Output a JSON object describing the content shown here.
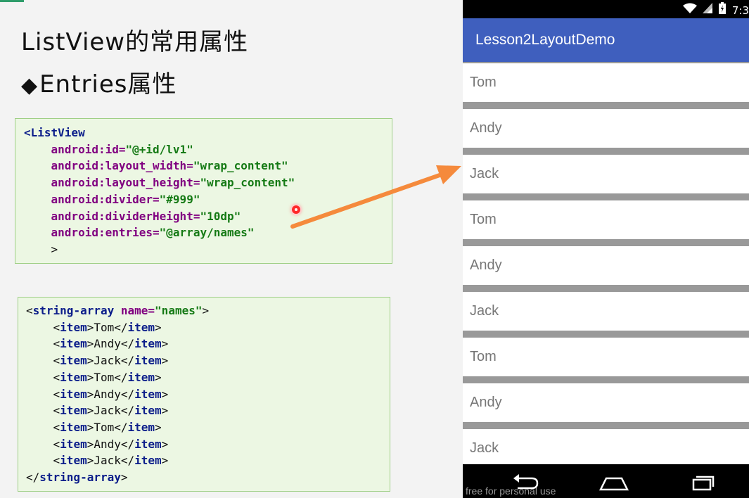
{
  "slide": {
    "title": "ListView的常用属性",
    "subtitle_bullet": "◆",
    "subtitle": "Entries属性",
    "code_listview": [
      [
        {
          "t": "tag",
          "s": "<ListView"
        }
      ],
      [
        {
          "t": "plain",
          "s": "    "
        },
        {
          "t": "attr",
          "s": "android:id="
        },
        {
          "t": "val",
          "s": "\"@+id/lv1\""
        }
      ],
      [
        {
          "t": "plain",
          "s": "    "
        },
        {
          "t": "attr",
          "s": "android:layout_width="
        },
        {
          "t": "val",
          "s": "\"wrap_content\""
        }
      ],
      [
        {
          "t": "plain",
          "s": "    "
        },
        {
          "t": "attr",
          "s": "android:layout_height="
        },
        {
          "t": "val",
          "s": "\"wrap_content\""
        }
      ],
      [
        {
          "t": "plain",
          "s": "    "
        },
        {
          "t": "attr",
          "s": "android:divider="
        },
        {
          "t": "val",
          "s": "\"#999\""
        }
      ],
      [
        {
          "t": "plain",
          "s": "    "
        },
        {
          "t": "attr",
          "s": "android:dividerHeight="
        },
        {
          "t": "val",
          "s": "\"10dp\""
        }
      ],
      [
        {
          "t": "plain",
          "s": "    "
        },
        {
          "t": "attr",
          "s": "android:entries="
        },
        {
          "t": "val",
          "s": "\"@array/names\""
        }
      ],
      [
        {
          "t": "plain",
          "s": "    >"
        }
      ]
    ],
    "code_string_array": [
      [
        {
          "t": "plain",
          "s": "<"
        },
        {
          "t": "tag",
          "s": "string-array "
        },
        {
          "t": "attr",
          "s": "name="
        },
        {
          "t": "val",
          "s": "\"names\""
        },
        {
          "t": "plain",
          "s": ">"
        }
      ],
      [
        {
          "t": "plain",
          "s": "    <"
        },
        {
          "t": "tag",
          "s": "item"
        },
        {
          "t": "plain",
          "s": ">Tom</"
        },
        {
          "t": "tag",
          "s": "item"
        },
        {
          "t": "plain",
          "s": ">"
        }
      ],
      [
        {
          "t": "plain",
          "s": "    <"
        },
        {
          "t": "tag",
          "s": "item"
        },
        {
          "t": "plain",
          "s": ">Andy</"
        },
        {
          "t": "tag",
          "s": "item"
        },
        {
          "t": "plain",
          "s": ">"
        }
      ],
      [
        {
          "t": "plain",
          "s": "    <"
        },
        {
          "t": "tag",
          "s": "item"
        },
        {
          "t": "plain",
          "s": ">Jack</"
        },
        {
          "t": "tag",
          "s": "item"
        },
        {
          "t": "plain",
          "s": ">"
        }
      ],
      [
        {
          "t": "plain",
          "s": "    <"
        },
        {
          "t": "tag",
          "s": "item"
        },
        {
          "t": "plain",
          "s": ">Tom</"
        },
        {
          "t": "tag",
          "s": "item"
        },
        {
          "t": "plain",
          "s": ">"
        }
      ],
      [
        {
          "t": "plain",
          "s": "    <"
        },
        {
          "t": "tag",
          "s": "item"
        },
        {
          "t": "plain",
          "s": ">Andy</"
        },
        {
          "t": "tag",
          "s": "item"
        },
        {
          "t": "plain",
          "s": ">"
        }
      ],
      [
        {
          "t": "plain",
          "s": "    <"
        },
        {
          "t": "tag",
          "s": "item"
        },
        {
          "t": "plain",
          "s": ">Jack</"
        },
        {
          "t": "tag",
          "s": "item"
        },
        {
          "t": "plain",
          "s": ">"
        }
      ],
      [
        {
          "t": "plain",
          "s": "    <"
        },
        {
          "t": "tag",
          "s": "item"
        },
        {
          "t": "plain",
          "s": ">Tom</"
        },
        {
          "t": "tag",
          "s": "item"
        },
        {
          "t": "plain",
          "s": ">"
        }
      ],
      [
        {
          "t": "plain",
          "s": "    <"
        },
        {
          "t": "tag",
          "s": "item"
        },
        {
          "t": "plain",
          "s": ">Andy</"
        },
        {
          "t": "tag",
          "s": "item"
        },
        {
          "t": "plain",
          "s": ">"
        }
      ],
      [
        {
          "t": "plain",
          "s": "    <"
        },
        {
          "t": "tag",
          "s": "item"
        },
        {
          "t": "plain",
          "s": ">Jack</"
        },
        {
          "t": "tag",
          "s": "item"
        },
        {
          "t": "plain",
          "s": ">"
        }
      ],
      [
        {
          "t": "plain",
          "s": "</"
        },
        {
          "t": "tag",
          "s": "string-array"
        },
        {
          "t": "plain",
          "s": ">"
        }
      ]
    ],
    "arrow_color": "#f58a3c"
  },
  "phone": {
    "status_time": "7:3",
    "icons": [
      "wifi-icon",
      "signal-icon",
      "battery-icon"
    ],
    "app_title": "Lesson2LayoutDemo",
    "app_bar_color": "#3f5fbe",
    "divider_color": "#999999",
    "list_items": [
      "Tom",
      "Andy",
      "Jack",
      "Tom",
      "Andy",
      "Jack",
      "Tom",
      "Andy",
      "Jack"
    ],
    "watermark": "free for personal use",
    "nav_icons": [
      "back-icon",
      "home-icon",
      "recents-icon"
    ]
  }
}
